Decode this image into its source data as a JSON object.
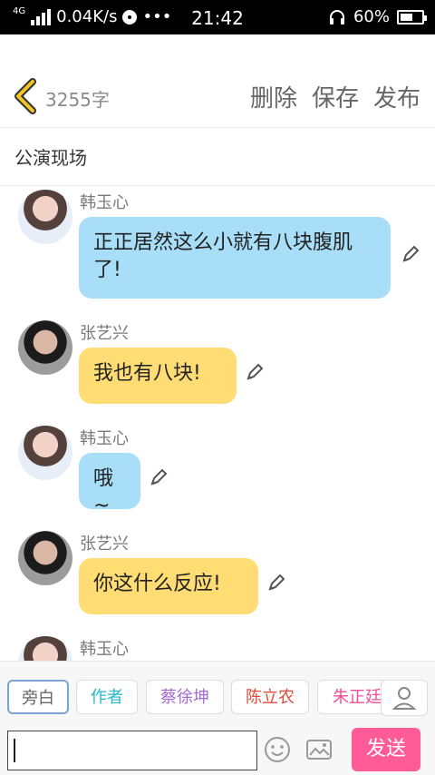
{
  "status_bar": {
    "network_label": "4G",
    "speed": "0.04K/s",
    "more": "•••",
    "time": "21:42",
    "battery": "60%",
    "battery_level": 0.6
  },
  "header": {
    "word_count": "3255字",
    "actions": [
      "删除",
      "保存",
      "发布"
    ]
  },
  "story_title": "公演现场",
  "messages": [
    {
      "name": "韩玉心",
      "text": "正正居然这么小就有八块腹肌了!",
      "bubble_color": "#a8def7",
      "avatar": "female"
    },
    {
      "name": "张艺兴",
      "text": "我也有八块!",
      "bubble_color": "#ffdd74",
      "avatar": "male"
    },
    {
      "name": "韩玉心",
      "text": "哦~",
      "bubble_color": "#a8def7",
      "avatar": "female"
    },
    {
      "name": "张艺兴",
      "text": "你这什么反应!",
      "bubble_color": "#ffdd74",
      "avatar": "male"
    },
    {
      "name": "韩玉心",
      "text": "",
      "bubble_color": "#a8def7",
      "avatar": "female"
    }
  ],
  "character_tags": [
    {
      "label": "旁白",
      "color": "#666666",
      "selected": true
    },
    {
      "label": "作者",
      "color": "#25b8c8",
      "selected": false
    },
    {
      "label": "蔡徐坤",
      "color": "#a36ad1",
      "selected": false
    },
    {
      "label": "陈立农",
      "color": "#e04a3c",
      "selected": false
    },
    {
      "label": "朱正廷",
      "color": "#ee4f9a",
      "selected": false
    }
  ],
  "composer": {
    "input_value": "",
    "send_label": "发送"
  },
  "colors": {
    "accent_back": "#f3c623",
    "send_bg": "#ff5c97"
  },
  "icons": {
    "emoji": "emoji-icon",
    "image": "image-icon",
    "person": "person-icon",
    "edit": "pencil-icon",
    "back": "chevron-left-icon"
  }
}
